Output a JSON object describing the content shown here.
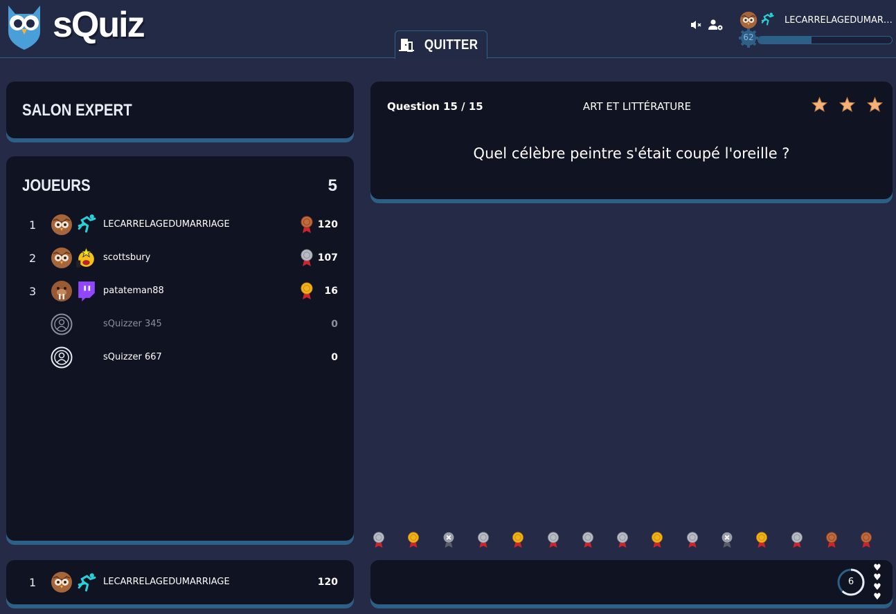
{
  "header": {
    "app_name": "sQuiz",
    "quit_label": "QUITTER",
    "user": {
      "name": "LECARRELAGEDUMARRIAGE",
      "level": "62",
      "xp_progress": 0.4
    }
  },
  "salon": {
    "title": "SALON EXPERT"
  },
  "players": {
    "title": "JOUEURS",
    "count": "5",
    "rows": [
      {
        "rank": "1",
        "name": "LECARRELAGEDUMARRIAGE",
        "medal": "bronze",
        "score": "120",
        "avatar": "owl-avatar",
        "badge": "runner-badge"
      },
      {
        "rank": "2",
        "name": "scottsbury",
        "medal": "silver",
        "score": "107",
        "avatar": "owl-avatar",
        "badge": "star-face-badge"
      },
      {
        "rank": "3",
        "name": "patateman88",
        "medal": "gold",
        "score": "16",
        "avatar": "walrus-avatar",
        "badge": "twitch-badge"
      },
      {
        "rank": "",
        "name": "sQuizzer 345",
        "medal": "",
        "score": "0",
        "avatar": "default-avatar",
        "badge": ""
      },
      {
        "rank": "",
        "name": "sQuizzer 667",
        "medal": "",
        "score": "0",
        "avatar": "default-avatar",
        "badge": ""
      }
    ]
  },
  "me": {
    "rank": "1",
    "name": "LECARRELAGEDUMARRIAGE",
    "score": "120"
  },
  "question": {
    "number_label": "Question 15 / 15",
    "category": "ART ET LITTÉRATURE",
    "difficulty_stars": 3,
    "text": "Quel célèbre peintre s'était coupé l'oreille ?"
  },
  "history": [
    "silver",
    "gold",
    "miss",
    "silver",
    "gold",
    "silver",
    "silver",
    "silver",
    "gold",
    "silver",
    "miss",
    "gold",
    "silver",
    "bronze",
    "bronze"
  ],
  "answer": {
    "timer": "6",
    "lives": 4
  },
  "colors": {
    "accent": "#2e5f86",
    "card": "#101422",
    "background": "#252b47",
    "gold": "#f2b21a",
    "silver": "#b9bcc4",
    "bronze": "#c26a3e",
    "ribbon": "#d0242a"
  }
}
